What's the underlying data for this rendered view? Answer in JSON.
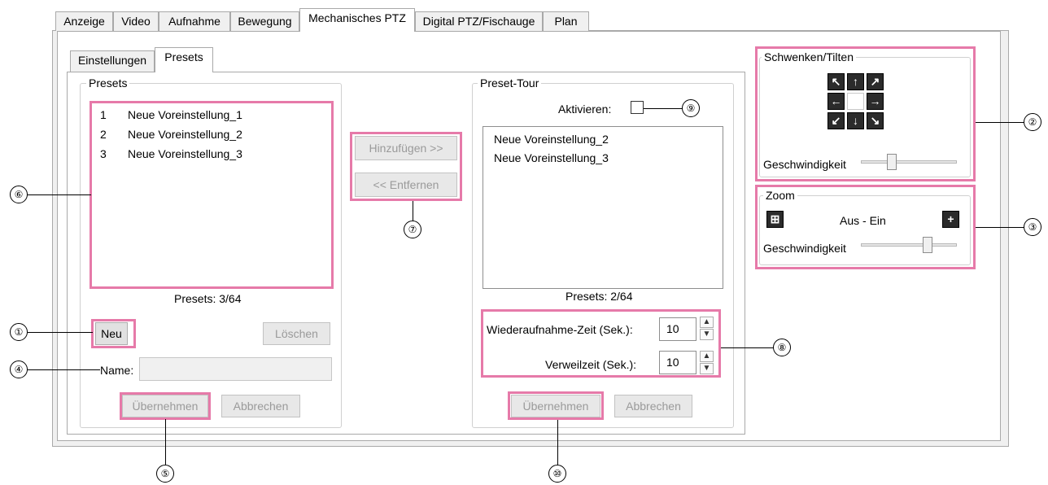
{
  "tabs": [
    "Anzeige",
    "Video",
    "Aufnahme",
    "Bewegung",
    "Mechanisches PTZ",
    "Digital PTZ/Fischauge",
    "Plan"
  ],
  "subtabs": [
    "Einstellungen",
    "Presets"
  ],
  "presets": {
    "group_label": "Presets",
    "items": [
      {
        "num": "1",
        "name": "Neue Voreinstellung_1"
      },
      {
        "num": "2",
        "name": "Neue Voreinstellung_2"
      },
      {
        "num": "3",
        "name": "Neue Voreinstellung_3"
      }
    ],
    "count": "Presets:  3/64",
    "new_label": "Neu",
    "delete_label": "Löschen",
    "name_label": "Name:",
    "name_value": "",
    "apply_label": "Übernehmen",
    "cancel_label": "Abbrechen"
  },
  "transfer": {
    "add_label": "Hinzufügen >>",
    "remove_label": "<< Entfernen"
  },
  "tour": {
    "group_label": "Preset-Tour",
    "activate_label": "Aktivieren:",
    "activate_checked": false,
    "items": [
      "Neue Voreinstellung_2",
      "Neue Voreinstellung_3"
    ],
    "count": "Presets:  2/64",
    "resume_label": "Wiederaufnahme-Zeit (Sek.):",
    "resume_value": "10",
    "dwell_label": "Verweilzeit (Sek.):",
    "dwell_value": "10",
    "apply_label": "Übernehmen",
    "cancel_label": "Abbrechen"
  },
  "pantilt": {
    "group_label": "Schwenken/Tilten",
    "speed_label": "Geschwindigkeit",
    "speed_level": 0.3
  },
  "zoom": {
    "group_label": "Zoom",
    "range_label": "Aus - Ein",
    "speed_label": "Geschwindigkeit",
    "speed_level": 0.72
  },
  "callouts": [
    "①",
    "②",
    "③",
    "④",
    "⑤",
    "⑥",
    "⑦",
    "⑧",
    "⑨",
    "⑩"
  ],
  "colors": {
    "highlight": "#e67aa9"
  }
}
